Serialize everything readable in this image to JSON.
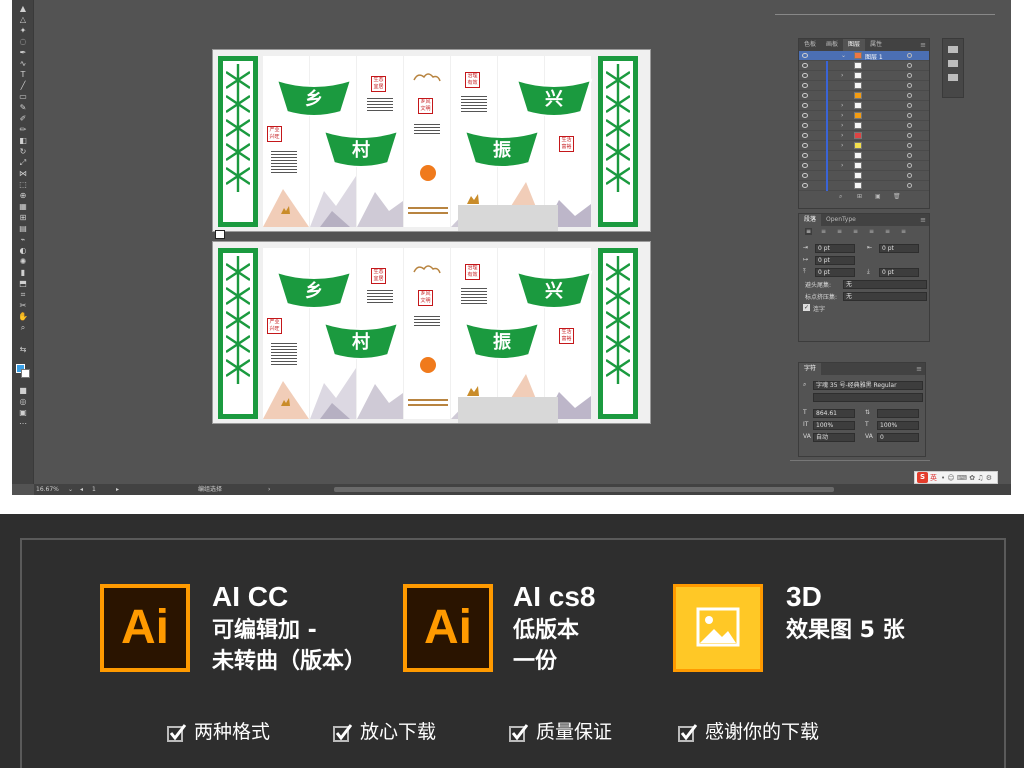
{
  "workspace": {
    "zoom": "16.67%",
    "page_number": "1",
    "status_text": "编组选择"
  },
  "artwork": {
    "fan_characters": [
      "乡",
      "村",
      "兴",
      "振"
    ],
    "seal_labels": [
      "生态宜居",
      "产业兴旺",
      "乡风文明",
      "治理有效",
      "生活富裕"
    ]
  },
  "layers_panel": {
    "tabs": [
      "色板",
      "画板",
      "图层",
      "属性"
    ],
    "active_tab": "图层",
    "top_layer_name": "图层 1"
  },
  "paragraph_panel": {
    "tabs": [
      "段落",
      "OpenType"
    ],
    "indent_values": [
      "0 pt",
      "0 pt",
      "0 pt",
      "0 pt",
      "0 pt"
    ],
    "kinsoku_label": "避头尾集:",
    "kinsoku_value": "无",
    "mojikumi_label": "标点挤压集:",
    "mojikumi_value": "无",
    "hyphenate_label": "连字"
  },
  "character_panel": {
    "title": "字符",
    "font": "字魂 35 号-经典雅黑 Regular",
    "font_size": "864.61",
    "scale_v": "100%",
    "scale_h": "100%",
    "leading": "自动",
    "tracking": "0",
    "baseline": "0"
  },
  "ime": {
    "label": "英"
  },
  "banner": {
    "features": [
      {
        "icon": "Ai",
        "title": "AI CC",
        "lines": [
          "可编辑加 -",
          "未转曲（版本）"
        ]
      },
      {
        "icon": "Ai",
        "title": "AI cs8",
        "lines": [
          "低版本",
          "一份"
        ]
      },
      {
        "icon": "image-icon",
        "title": "3D",
        "lines": [
          "效果图 5 张"
        ]
      }
    ],
    "checks": [
      "两种格式",
      "放心下载",
      "质量保证",
      "感谢你的下载"
    ]
  },
  "colors": {
    "workspace_bg": "#535353",
    "panel_dark": "#424242",
    "green": "#1b9a3f",
    "ai_orange": "#ff9a00",
    "ai_brown": "#2a1400",
    "image_yellow": "#ffc826",
    "banner_bg": "#2e2e2e"
  }
}
